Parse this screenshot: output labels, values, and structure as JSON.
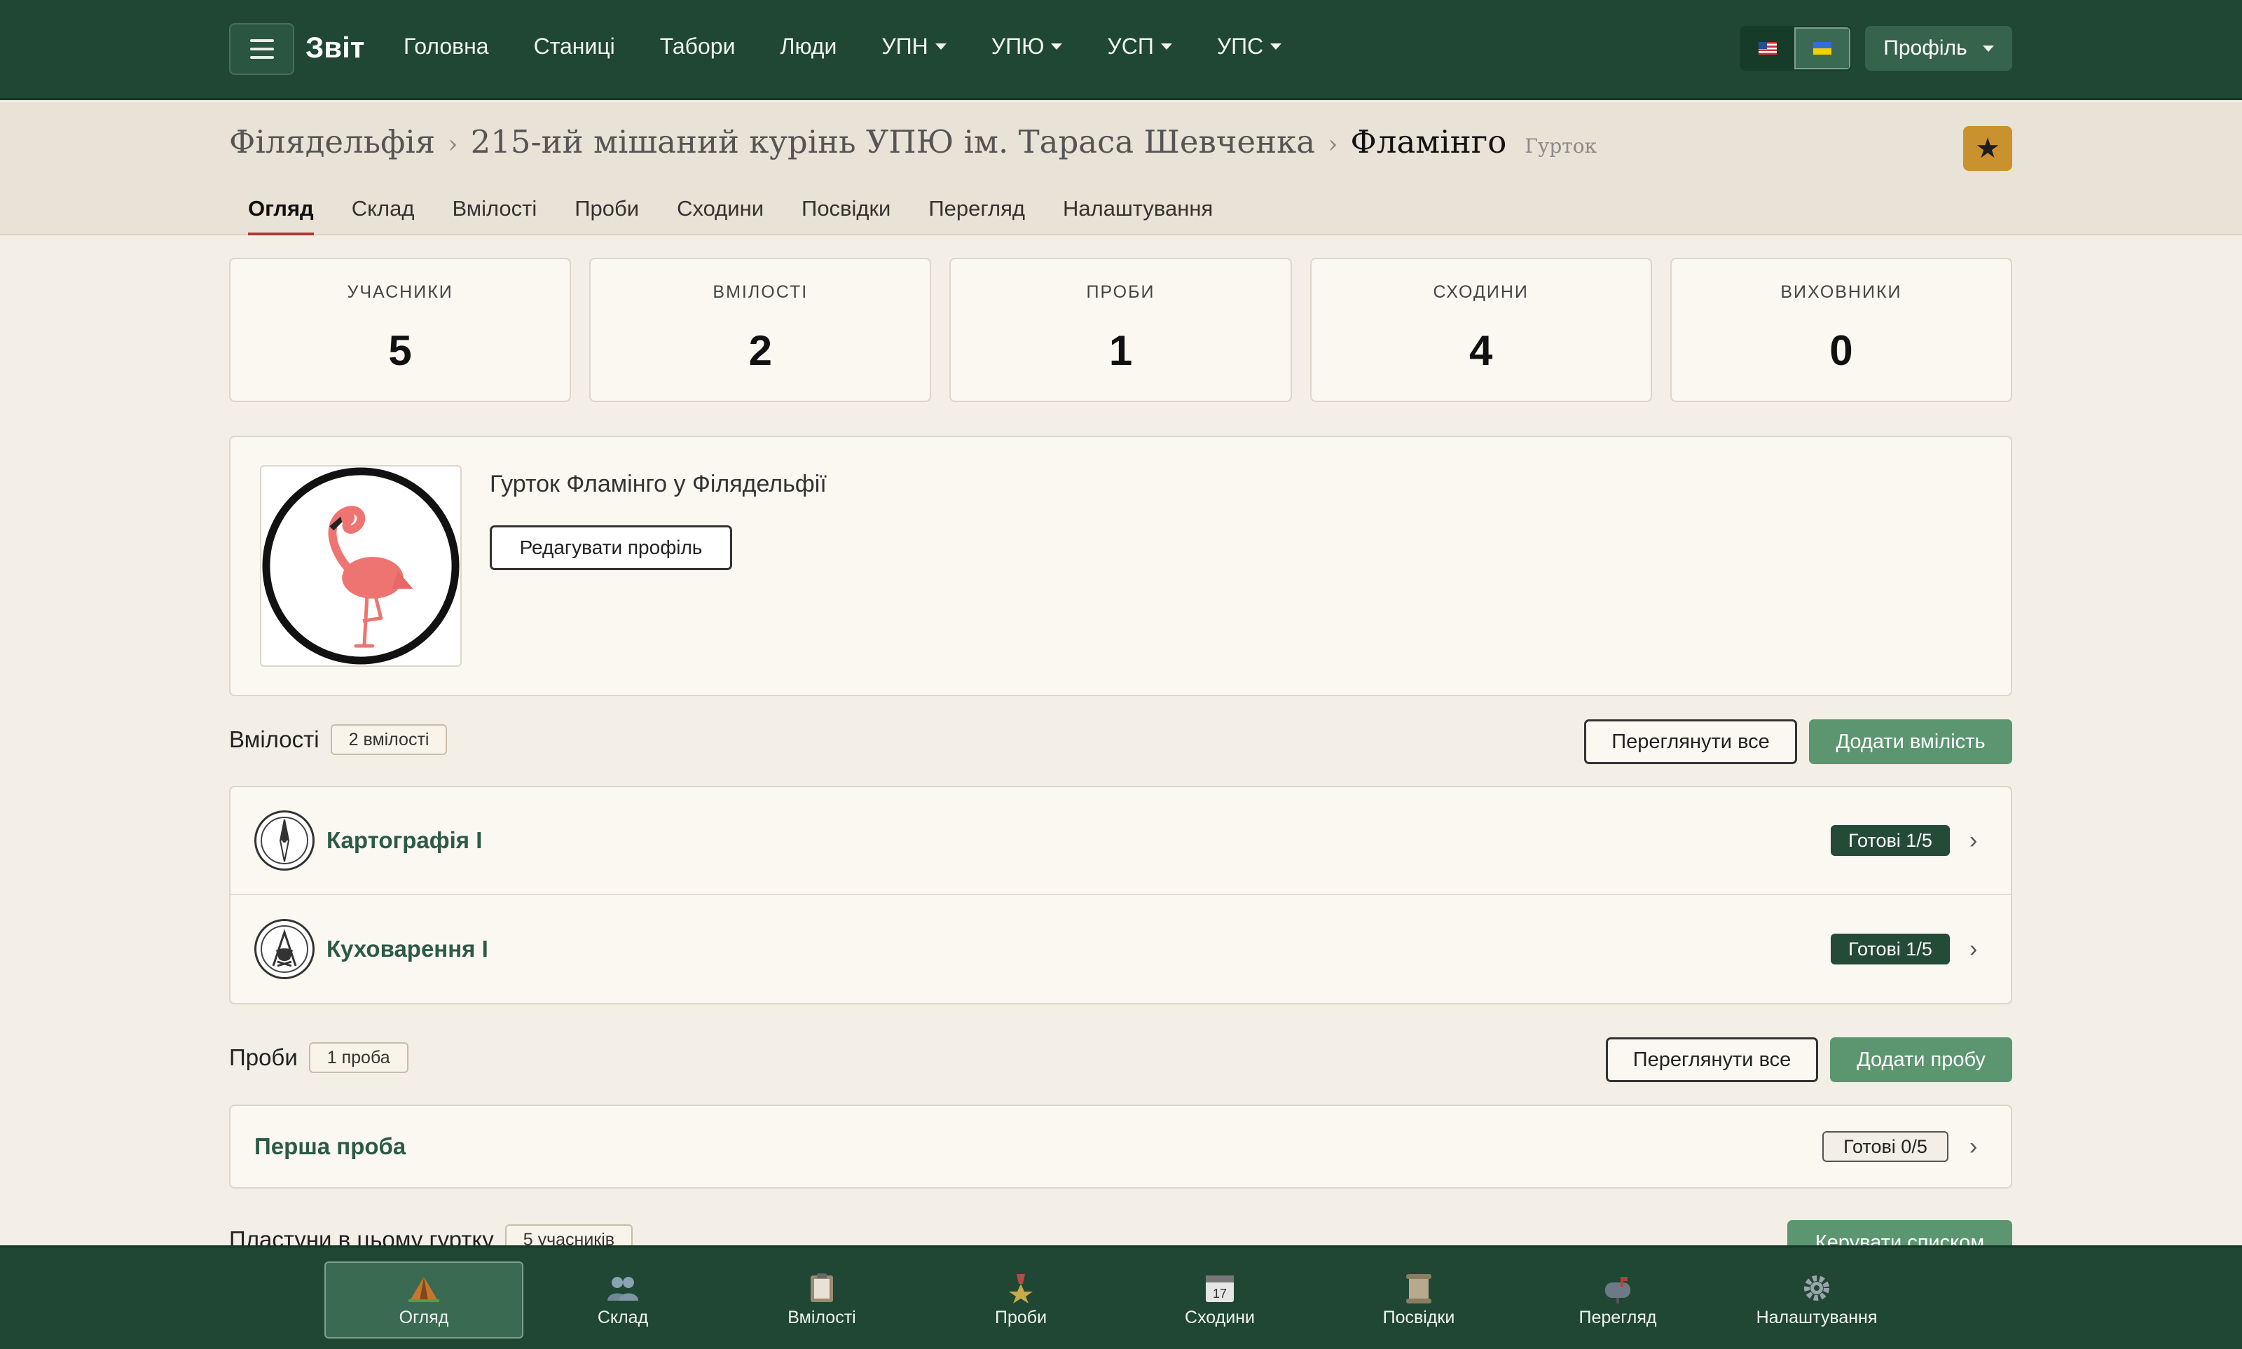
{
  "nav": {
    "brand": "Звіт",
    "links": [
      "Головна",
      "Станиці",
      "Табори",
      "Люди"
    ],
    "dropdowns": [
      "УПН",
      "УПЮ",
      "УСП",
      "УПС"
    ],
    "profile_label": "Профіль"
  },
  "breadcrumb": {
    "items": [
      "Філядельфія",
      "215-ий мішаний курінь УПЮ ім. Тараса Шевченка"
    ],
    "current": "Фламінго",
    "type": "Гурток"
  },
  "tabs": [
    "Огляд",
    "Склад",
    "Вмілості",
    "Проби",
    "Сходини",
    "Посвідки",
    "Перегляд",
    "Налаштування"
  ],
  "stats": [
    {
      "label": "УЧАСНИКИ",
      "value": "5"
    },
    {
      "label": "ВМІЛОСТІ",
      "value": "2"
    },
    {
      "label": "ПРОБИ",
      "value": "1"
    },
    {
      "label": "СХОДИНИ",
      "value": "4"
    },
    {
      "label": "ВИХОВНИКИ",
      "value": "0"
    }
  ],
  "profile": {
    "description": "Гурток Фламінго у Філядельфії",
    "edit_label": "Редагувати профіль"
  },
  "skills": {
    "title": "Вмілості",
    "count": "2 вмілості",
    "view_all": "Переглянути все",
    "add": "Додати вмілість",
    "items": [
      {
        "name": "Картографія I",
        "status": "Готові 1/5",
        "icon": "compass-icon"
      },
      {
        "name": "Куховарення I",
        "status": "Готові 1/5",
        "icon": "campfire-icon"
      }
    ]
  },
  "trials": {
    "title": "Проби",
    "count": "1 проба",
    "view_all": "Переглянути все",
    "add": "Додати пробу",
    "items": [
      {
        "name": "Перша проба",
        "status": "Готові 0/5"
      }
    ]
  },
  "members": {
    "title": "Пластуни в цьому гуртку",
    "count": "5 учасників",
    "manage": "Керувати списком"
  },
  "bottom_nav": [
    {
      "label": "Огляд",
      "icon": "tent-icon"
    },
    {
      "label": "Склад",
      "icon": "people-icon"
    },
    {
      "label": "Вмілості",
      "icon": "clipboard-icon"
    },
    {
      "label": "Проби",
      "icon": "medal-icon"
    },
    {
      "label": "Сходини",
      "icon": "calendar-icon"
    },
    {
      "label": "Посвідки",
      "icon": "scroll-icon"
    },
    {
      "label": "Перегляд",
      "icon": "mailbox-icon"
    },
    {
      "label": "Налаштування",
      "icon": "gear-icon"
    }
  ],
  "colors": {
    "nav_bg": "#1f4733",
    "accent_green": "#5b9670",
    "star_gold": "#c9922f",
    "active_tab_underline": "#b03636"
  }
}
